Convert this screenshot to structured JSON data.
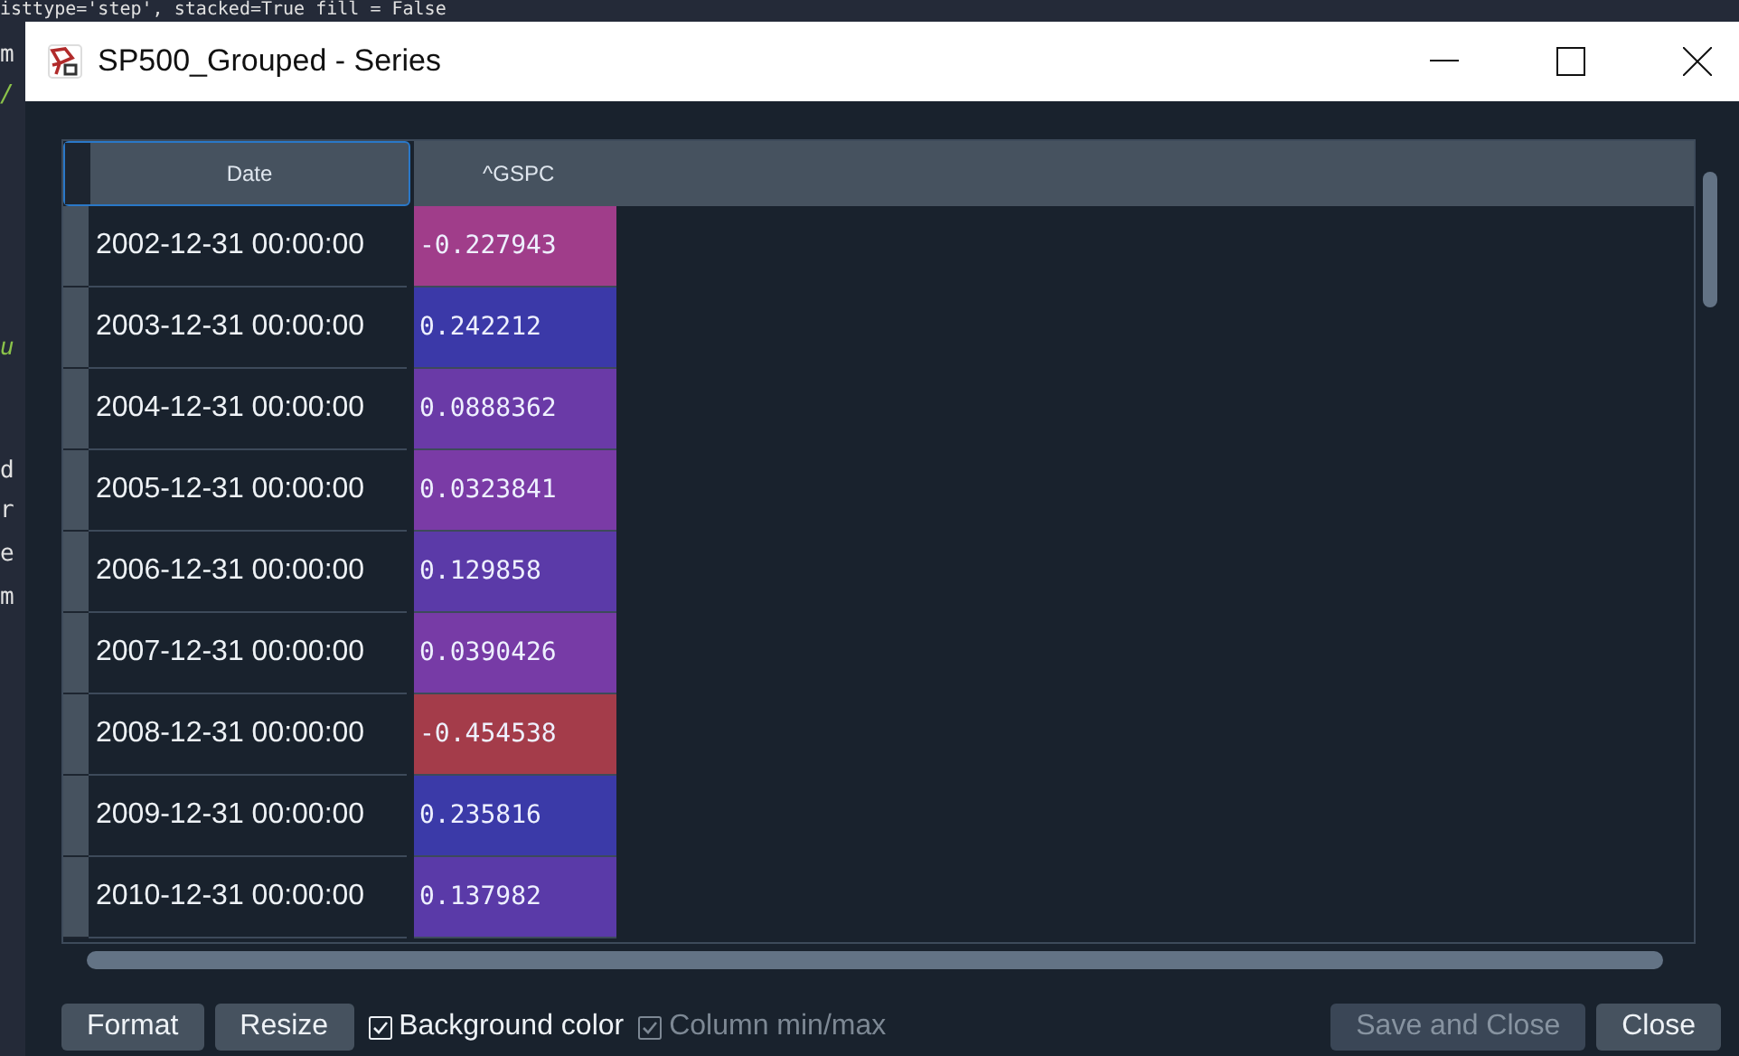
{
  "editor_backdrop": {
    "top_line": "isttype='step', stacked=True fill = False",
    "side_fragments": [
      {
        "text": "m",
        "kind": "code"
      },
      {
        "text": "/",
        "kind": "comment"
      },
      {
        "text": "u",
        "kind": "comment"
      },
      {
        "text": "d",
        "kind": "code"
      },
      {
        "text": "r",
        "kind": "code"
      },
      {
        "text": "e",
        "kind": "code"
      },
      {
        "text": "m",
        "kind": "code"
      }
    ]
  },
  "window": {
    "title": "SP500_Grouped - Series"
  },
  "table": {
    "columns": [
      "Date",
      "^GSPC"
    ],
    "rows": [
      {
        "date": "2002-12-31 00:00:00",
        "value": "-0.227943",
        "color": "#a03d8a"
      },
      {
        "date": "2003-12-31 00:00:00",
        "value": "0.242212",
        "color": "#3b39a8"
      },
      {
        "date": "2004-12-31 00:00:00",
        "value": "0.0888362",
        "color": "#6a3aa7"
      },
      {
        "date": "2005-12-31 00:00:00",
        "value": "0.0323841",
        "color": "#7a3ba6"
      },
      {
        "date": "2006-12-31 00:00:00",
        "value": "0.129858",
        "color": "#5b3aa8"
      },
      {
        "date": "2007-12-31 00:00:00",
        "value": "0.0390426",
        "color": "#773ba6"
      },
      {
        "date": "2008-12-31 00:00:00",
        "value": "-0.454538",
        "color": "#a43c4a"
      },
      {
        "date": "2009-12-31 00:00:00",
        "value": "0.235816",
        "color": "#3b3aa8"
      },
      {
        "date": "2010-12-31 00:00:00",
        "value": "0.137982",
        "color": "#5a3aa8"
      }
    ]
  },
  "footer": {
    "buttons": [
      {
        "label": "Format",
        "disabled": false
      },
      {
        "label": "Resize",
        "disabled": false
      }
    ],
    "checkboxes": [
      {
        "label": "Background color",
        "checked": true,
        "disabled": false
      },
      {
        "label": "Column min/max",
        "checked": true,
        "disabled": true
      }
    ],
    "actions": [
      {
        "label": "Save and Close",
        "disabled": true
      },
      {
        "label": "Close",
        "disabled": false
      }
    ]
  }
}
